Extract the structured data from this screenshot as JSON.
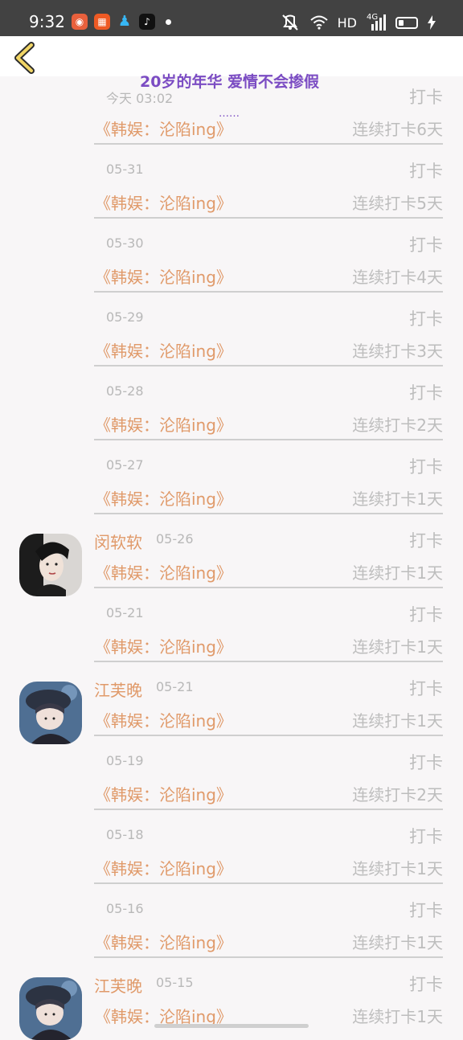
{
  "status_bar": {
    "time": "9:32",
    "network": "HD",
    "signal_label": "4G",
    "icons": [
      "huoshan-app-icon",
      "grid-app-icon",
      "qq-penguin-icon",
      "tiktok-icon",
      "mute-vibrate-icon",
      "wifi-icon",
      "signal-icon",
      "battery-icon",
      "charging-icon"
    ]
  },
  "header": {
    "back_icon": "chevron-left-icon",
    "overlay_title": "20岁的年华 爱情不会掺假",
    "overlay_dots": "……"
  },
  "feed": {
    "checkin_label": "打卡",
    "rows": [
      {
        "name": "",
        "date": "今天 03:02",
        "book": "《韩娱：沦陷ing》",
        "streak": "连续打卡6天",
        "avatar": ""
      },
      {
        "name": "",
        "date": "05-31",
        "book": "《韩娱：沦陷ing》",
        "streak": "连续打卡5天",
        "avatar": ""
      },
      {
        "name": "",
        "date": "05-30",
        "book": "《韩娱：沦陷ing》",
        "streak": "连续打卡4天",
        "avatar": ""
      },
      {
        "name": "",
        "date": "05-29",
        "book": "《韩娱：沦陷ing》",
        "streak": "连续打卡3天",
        "avatar": ""
      },
      {
        "name": "",
        "date": "05-28",
        "book": "《韩娱：沦陷ing》",
        "streak": "连续打卡2天",
        "avatar": ""
      },
      {
        "name": "",
        "date": "05-27",
        "book": "《韩娱：沦陷ing》",
        "streak": "连续打卡1天",
        "avatar": ""
      },
      {
        "name": "闵软软",
        "date": "05-26",
        "book": "《韩娱：沦陷ing》",
        "streak": "连续打卡1天",
        "avatar": "woman-portrait"
      },
      {
        "name": "",
        "date": "05-21",
        "book": "《韩娱：沦陷ing》",
        "streak": "连续打卡1天",
        "avatar": ""
      },
      {
        "name": "江芙晚",
        "date": "05-21",
        "book": "《韩娱：沦陷ing》",
        "streak": "连续打卡1天",
        "avatar": "beret-portrait"
      },
      {
        "name": "",
        "date": "05-19",
        "book": "《韩娱：沦陷ing》",
        "streak": "连续打卡2天",
        "avatar": ""
      },
      {
        "name": "",
        "date": "05-18",
        "book": "《韩娱：沦陷ing》",
        "streak": "连续打卡1天",
        "avatar": ""
      },
      {
        "name": "",
        "date": "05-16",
        "book": "《韩娱：沦陷ing》",
        "streak": "连续打卡1天",
        "avatar": ""
      },
      {
        "name": "江芙晚",
        "date": "05-15",
        "book": "《韩娱：沦陷ing》",
        "streak": "连续打卡1天",
        "avatar": "beret-portrait"
      }
    ]
  },
  "colors": {
    "accent": "#e09a6a",
    "muted": "#bdbdbd",
    "overlay_text": "#7b4cc3",
    "status_bar": "#424242",
    "background": "#f8f6f7"
  }
}
